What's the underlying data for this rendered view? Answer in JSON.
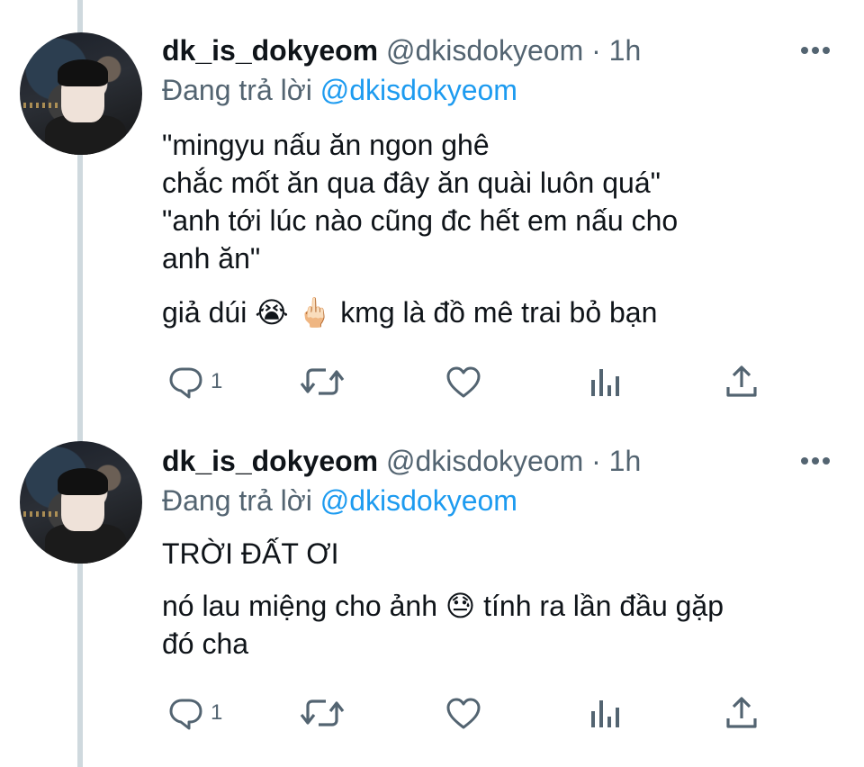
{
  "tweets": [
    {
      "display_name": "dk_is_dokyeom",
      "handle": "@dkisdokyeom",
      "separator": "·",
      "time": "1h",
      "reply_prefix": "Đang trả lời",
      "reply_mention": "@dkisdokyeom",
      "lines": [
        "\"mingyu nấu ăn ngon ghê",
        "chắc mốt ăn qua đây ăn quài luôn quá\"",
        "\"anh tới lúc nào cũng đc hết em nấu cho",
        "anh ăn\"",
        "giả dúi 😭 🖕🏻 kmg là đồ mê trai bỏ bạn"
      ],
      "reply_count": "1"
    },
    {
      "display_name": "dk_is_dokyeom",
      "handle": "@dkisdokyeom",
      "separator": "·",
      "time": "1h",
      "reply_prefix": "Đang trả lời",
      "reply_mention": "@dkisdokyeom",
      "lines": [
        "TRỜI ĐẤT ƠI",
        "nó lau miệng cho ảnh 😓 tính ra lần đầu gặp",
        "đó cha"
      ],
      "reply_count": "1"
    }
  ],
  "icons": [
    "reply-icon",
    "retweet-icon",
    "like-icon",
    "analytics-icon",
    "share-icon",
    "more-icon"
  ],
  "colors": {
    "text": "#0f1419",
    "secondary": "#536471",
    "mention": "#1d9bf0",
    "thread_line": "#cfd9de"
  }
}
